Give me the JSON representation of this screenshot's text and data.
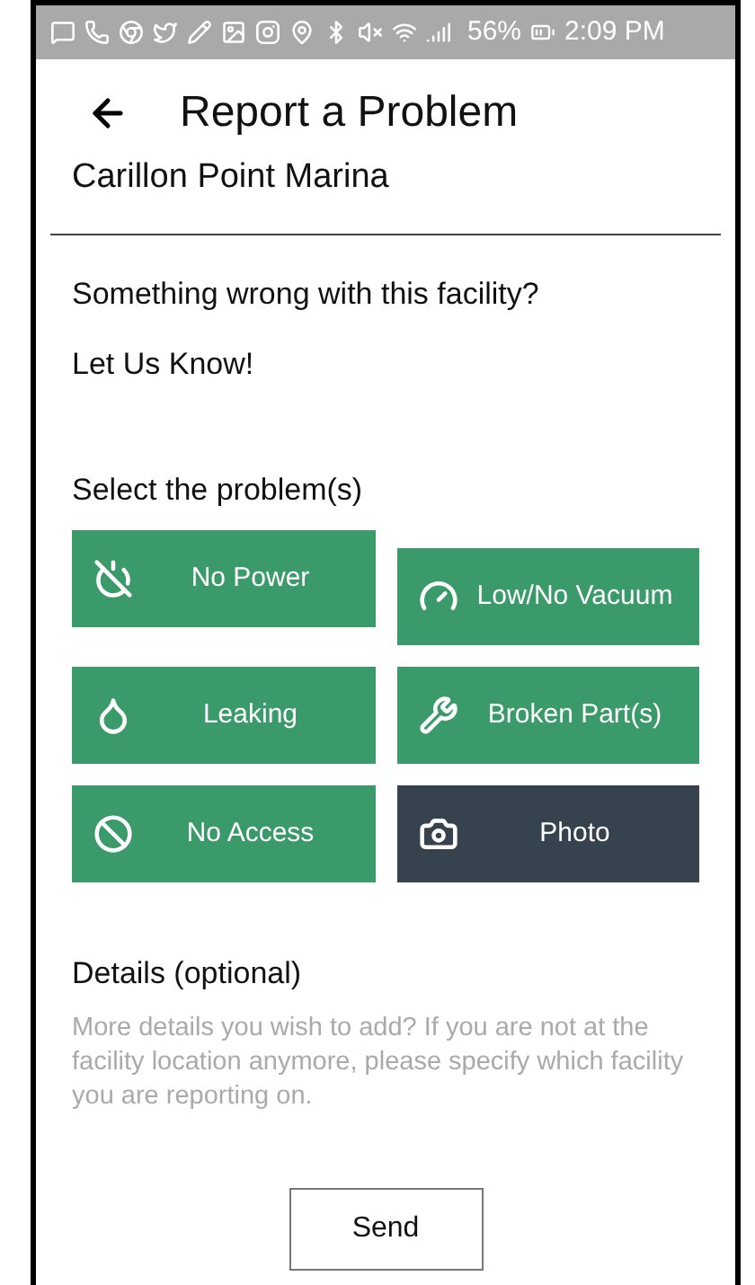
{
  "status_bar": {
    "battery": "56%",
    "time": "2:09 PM"
  },
  "header": {
    "title": "Report a Problem",
    "subtitle": "Carillon Point Marina"
  },
  "intro": [
    "Something wrong with this facility?",
    "Let Us Know!"
  ],
  "problems": {
    "heading": "Select the problem(s)",
    "buttons": [
      {
        "label": "No Power",
        "kind": "problem"
      },
      {
        "label": "Low/No Vacuum",
        "kind": "problem"
      },
      {
        "label": "Leaking",
        "kind": "problem"
      },
      {
        "label": "Broken Part(s)",
        "kind": "problem"
      },
      {
        "label": "No Access",
        "kind": "problem"
      },
      {
        "label": "Photo",
        "kind": "photo"
      }
    ]
  },
  "details": {
    "label": "Details (optional)",
    "placeholder": "More details you wish to add? If you are not at the facility location anymore, please specify which facility you are reporting on."
  },
  "send_button": "Send"
}
